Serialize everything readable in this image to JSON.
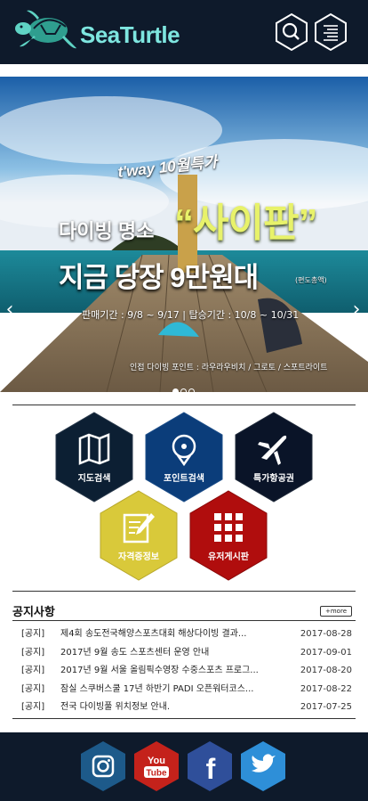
{
  "header": {
    "brand": "SeaTurtle",
    "search_icon": "search-icon",
    "menu_icon": "menu-icon"
  },
  "hero": {
    "promo_small": "t'way 10월특가",
    "promo_line1": "다이빙 명소",
    "promo_saipan": "“사이판”",
    "promo_line2": "지금 당장 9만원대",
    "promo_note": "(편도총액)",
    "promo_period": "판매기간 : 9/8 ~ 9/17 | 탑승기간 : 10/8 ~ 10/31",
    "caption": "인접 다이빙 포인트 : 라우라우비치 / 그로토 / 스포트라이트",
    "prev_icon": "‹",
    "next_icon": "›",
    "slides": 3,
    "active_slide": 1
  },
  "menu_tiles": [
    {
      "label": "지도검색",
      "icon": "map-icon",
      "color": "#0c1f33"
    },
    {
      "label": "포인트검색",
      "icon": "location-pin-icon",
      "color": "#0b3d7a"
    },
    {
      "label": "특가항공권",
      "icon": "airplane-icon",
      "color": "#0a1428"
    },
    {
      "label": "자격증정보",
      "icon": "certificate-edit-icon",
      "color": "#d9c93a"
    },
    {
      "label": "유저게시판",
      "icon": "grid-board-icon",
      "color": "#b00d0d"
    }
  ],
  "notices": {
    "title": "공지사항",
    "more": "+more",
    "items": [
      {
        "tag": "[공지]",
        "text": "제4회 송도전국해양스포츠대회 해상다이빙 결과...",
        "date": "2017-08-28"
      },
      {
        "tag": "[공지]",
        "text": "2017년 9월 송도 스포츠센터 운영 안내",
        "date": "2017-09-01"
      },
      {
        "tag": "[공지]",
        "text": "2017년 9월 서울 올림픽수영장 수중스포츠 프로그...",
        "date": "2017-08-20"
      },
      {
        "tag": "[공지]",
        "text": "잠실 스쿠버스쿨 17년 하반기 PADI 오픈워터코스...",
        "date": "2017-08-22"
      },
      {
        "tag": "[공지]",
        "text": "전국 다이빙풀 위치정보 안내.",
        "date": "2017-07-25"
      }
    ]
  },
  "footer": {
    "sns": [
      {
        "name": "instagram-icon",
        "color": "#1d5a8a"
      },
      {
        "name": "youtube-icon",
        "color": "#c4221b"
      },
      {
        "name": "facebook-icon",
        "color": "#2f4f9a"
      },
      {
        "name": "twitter-icon",
        "color": "#2e8fd8"
      }
    ]
  }
}
